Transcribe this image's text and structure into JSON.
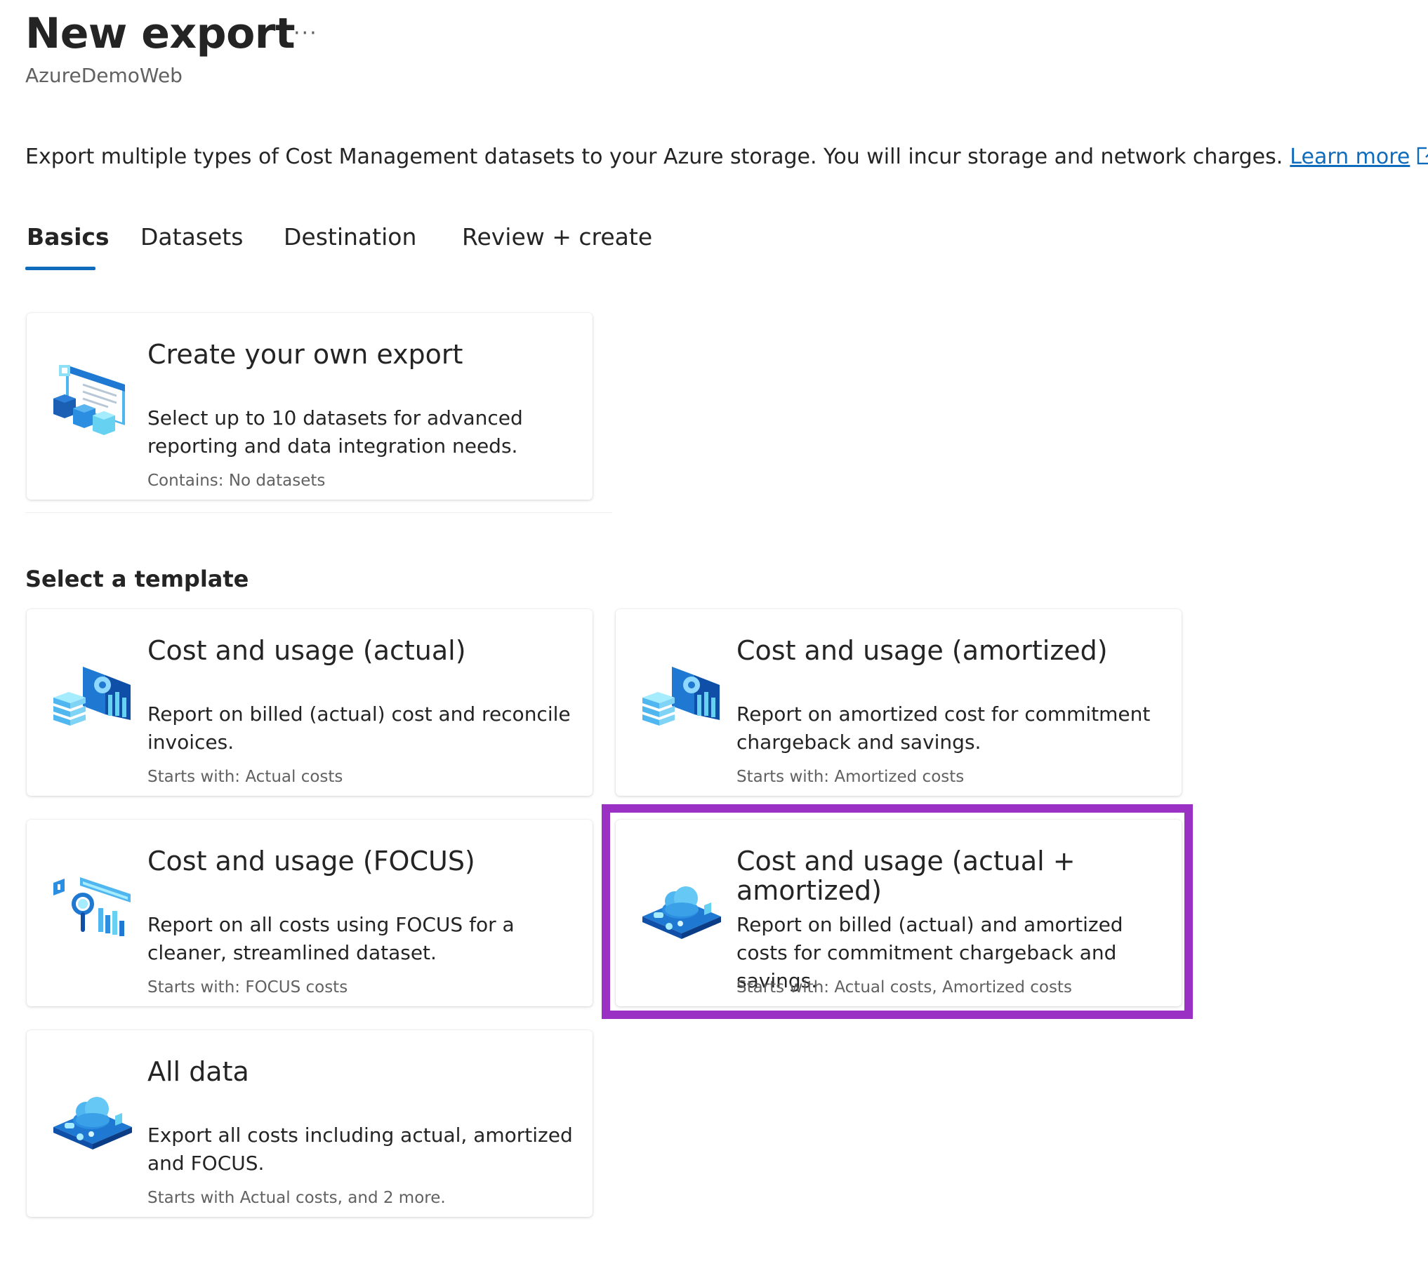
{
  "header": {
    "title": "New export",
    "more_label": "···",
    "subtitle": "AzureDemoWeb"
  },
  "intro": {
    "text": "Export multiple types of Cost Management datasets to your Azure storage. You will incur storage and network charges.",
    "link_label": "Learn more",
    "link_icon": "external-link-icon"
  },
  "tabs": [
    {
      "label": "Basics",
      "active": true
    },
    {
      "label": "Datasets",
      "active": false
    },
    {
      "label": "Destination",
      "active": false
    },
    {
      "label": "Review + create",
      "active": false
    }
  ],
  "custom_card": {
    "title": "Create your own export",
    "description": "Select up to 10 datasets for advanced reporting and data integration needs.",
    "meta": "Contains: No datasets",
    "icon": "custom-export-icon"
  },
  "templates": {
    "heading": "Select a template",
    "items": [
      {
        "title": "Cost and usage (actual)",
        "description": "Report on billed (actual) cost and reconcile invoices.",
        "meta": "Starts with: Actual costs",
        "icon": "cost-report-icon"
      },
      {
        "title": "Cost and usage (amortized)",
        "description": "Report on amortized cost for commitment chargeback and savings.",
        "meta": "Starts with: Amortized costs",
        "icon": "cost-report-icon"
      },
      {
        "title": "Cost and usage (FOCUS)",
        "description": "Report on all costs using FOCUS for a cleaner, streamlined dataset.",
        "meta": "Starts with: FOCUS costs",
        "icon": "focus-analytics-icon"
      },
      {
        "title": "Cost and usage (actual + amortized)",
        "description": "Report on billed (actual) and amortized costs for commitment chargeback and savings.",
        "meta": "Starts with: Actual costs, Amortized costs",
        "icon": "cloud-platform-icon",
        "highlighted": true
      },
      {
        "title": "All data",
        "description": "Export all costs including actual, amortized and FOCUS.",
        "meta": "Starts with Actual costs, and 2 more.",
        "icon": "cloud-platform-icon"
      }
    ]
  },
  "colors": {
    "accent": "#0f6cbd",
    "highlight": "#9b30c4",
    "text_primary": "#242424",
    "text_secondary": "#616161"
  }
}
